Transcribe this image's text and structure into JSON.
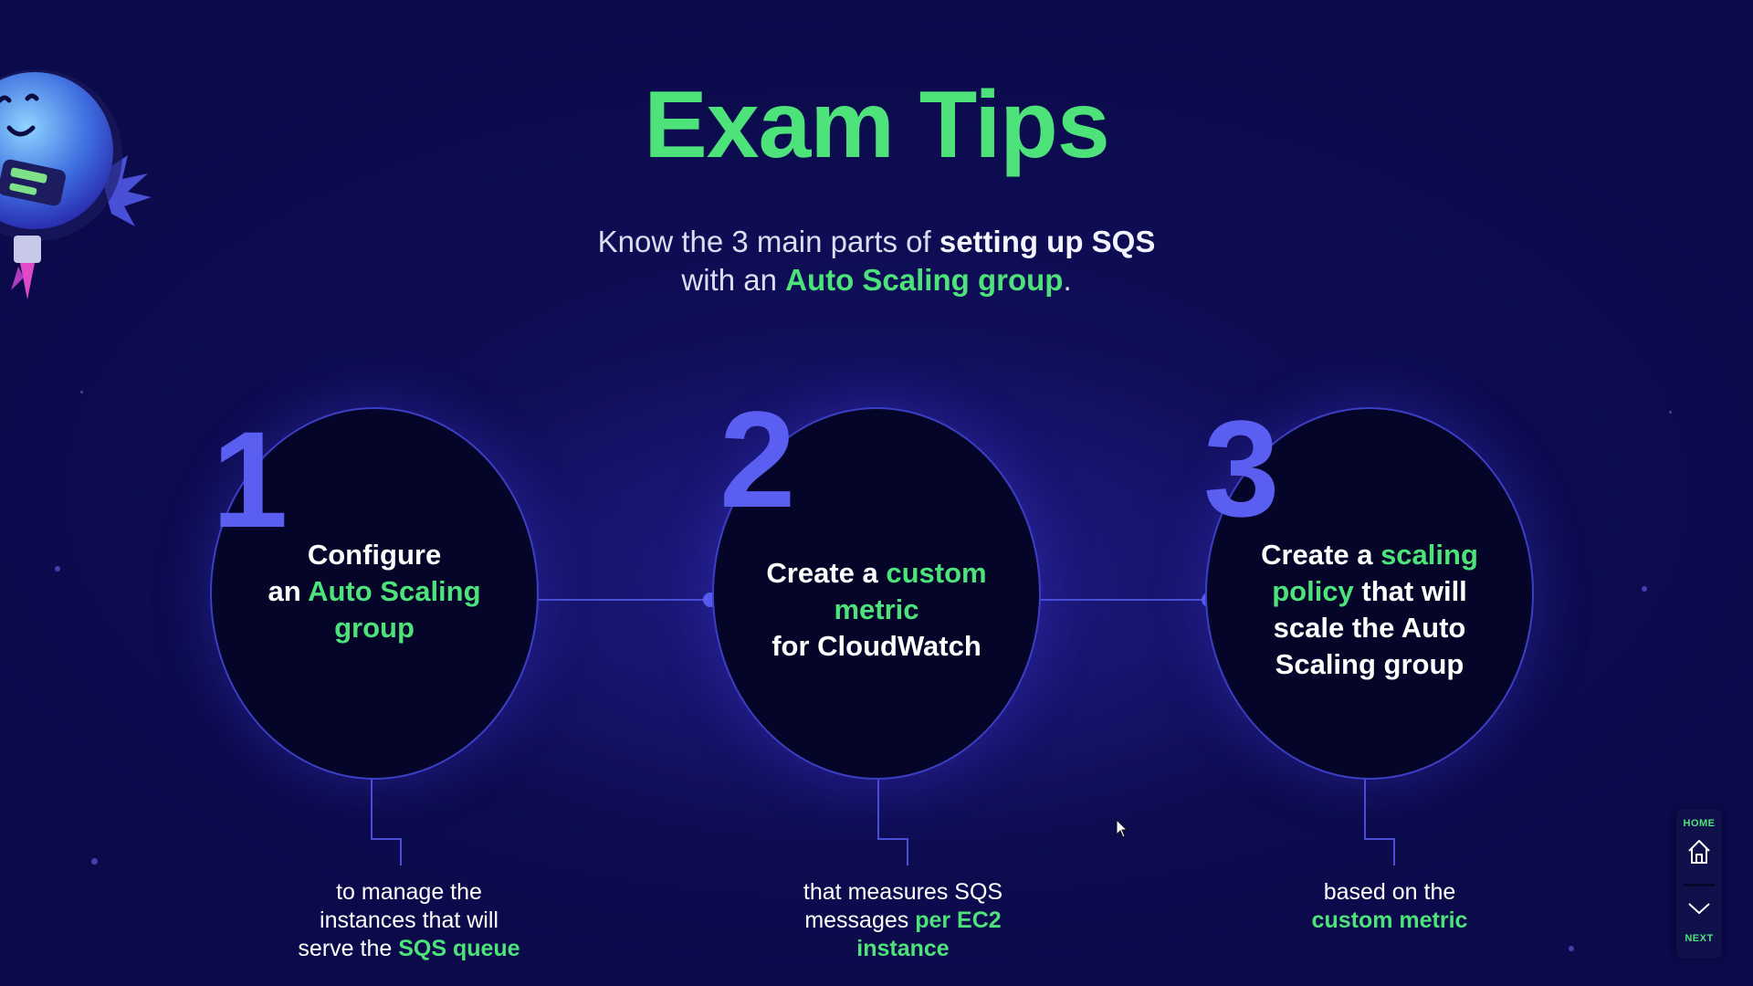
{
  "slide": {
    "title": "Exam Tips",
    "subtitle": {
      "line1_pre": "Know the 3 main parts of ",
      "line1_bold": "setting up SQS",
      "line2_pre": "with an ",
      "line2_green": "Auto Scaling group",
      "line2_post": "."
    }
  },
  "steps": [
    {
      "number": "1",
      "text_lines": [
        {
          "parts": [
            {
              "t": "Configure",
              "green": false
            }
          ]
        },
        {
          "parts": [
            {
              "t": "an ",
              "green": false
            },
            {
              "t": "Auto Scaling",
              "green": true
            }
          ]
        },
        {
          "parts": [
            {
              "t": "group",
              "green": true
            }
          ]
        }
      ],
      "caption_lines": [
        {
          "parts": [
            {
              "t": "to manage the",
              "green": false
            }
          ]
        },
        {
          "parts": [
            {
              "t": "instances that will",
              "green": false
            }
          ]
        },
        {
          "parts": [
            {
              "t": "serve the ",
              "green": false
            },
            {
              "t": "SQS queue",
              "green": true
            }
          ]
        }
      ]
    },
    {
      "number": "2",
      "text_lines": [
        {
          "parts": [
            {
              "t": "Create a ",
              "green": false
            },
            {
              "t": "custom",
              "green": true
            }
          ]
        },
        {
          "parts": [
            {
              "t": "metric",
              "green": true
            }
          ]
        },
        {
          "parts": [
            {
              "t": "for CloudWatch",
              "green": false
            }
          ]
        }
      ],
      "caption_lines": [
        {
          "parts": [
            {
              "t": "that measures SQS",
              "green": false
            }
          ]
        },
        {
          "parts": [
            {
              "t": "messages ",
              "green": false
            },
            {
              "t": "per EC2",
              "green": true
            }
          ]
        },
        {
          "parts": [
            {
              "t": "instance",
              "green": true
            }
          ]
        }
      ]
    },
    {
      "number": "3",
      "text_lines": [
        {
          "parts": [
            {
              "t": "Create a ",
              "green": false
            },
            {
              "t": "scaling",
              "green": true
            }
          ]
        },
        {
          "parts": [
            {
              "t": "policy",
              "green": true
            },
            {
              "t": " that will",
              "green": false
            }
          ]
        },
        {
          "parts": [
            {
              "t": "scale the Auto",
              "green": false
            }
          ]
        },
        {
          "parts": [
            {
              "t": "Scaling group",
              "green": false
            }
          ]
        }
      ],
      "caption_lines": [
        {
          "parts": [
            {
              "t": "based on the",
              "green": false
            }
          ]
        },
        {
          "parts": [
            {
              "t": "custom metric",
              "green": true
            }
          ]
        }
      ]
    }
  ],
  "nav": {
    "home_label": "HOME",
    "next_label": "NEXT",
    "home_icon": "home-icon",
    "next_icon": "chevron-down-icon"
  },
  "colors": {
    "background": "#0b0a4a",
    "accent_green": "#4ee37a",
    "accent_blue": "#5a5ff2"
  }
}
